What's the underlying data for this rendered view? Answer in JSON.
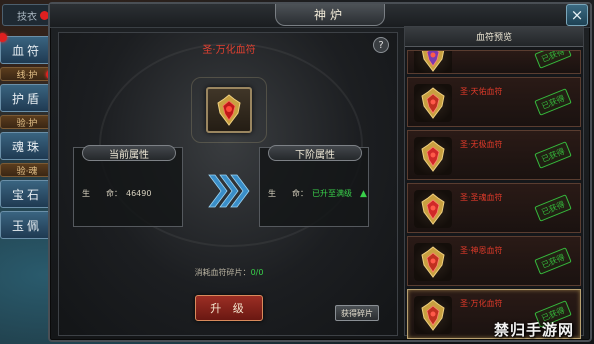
{
  "side": {
    "top_label": "技衣",
    "tabs": [
      {
        "label": "血符",
        "type": "main"
      },
      {
        "label": "线·护",
        "type": "sub"
      },
      {
        "label": "护盾",
        "type": "main"
      },
      {
        "label": "验·护",
        "type": "sub"
      },
      {
        "label": "魂珠",
        "type": "main"
      },
      {
        "label": "验·魂",
        "type": "sub"
      },
      {
        "label": "宝石",
        "type": "main"
      },
      {
        "label": "玉佩",
        "type": "main"
      }
    ]
  },
  "window": {
    "title": "神炉",
    "close_icon": "×"
  },
  "furnace": {
    "title": "圣·万化血符",
    "help_icon": "?",
    "current_head": "当前属性",
    "next_head": "下阶属性",
    "current_attr": {
      "label": "生　　命：",
      "value": "46490"
    },
    "next_attr": {
      "label": "生　　命：",
      "value": "已升至满级"
    },
    "consume_label": "消耗血符碎片：",
    "consume_value": "0/0",
    "upgrade_label": "升 级",
    "get_label": "获得碎片"
  },
  "list": {
    "title": "血符预览",
    "items": [
      {
        "name": "",
        "stamp": "已获得",
        "color": "#7a3ab0"
      },
      {
        "name": "圣·天佑血符",
        "stamp": "已获得",
        "color": "#c03020"
      },
      {
        "name": "圣·无极血符",
        "stamp": "已获得",
        "color": "#d02828"
      },
      {
        "name": "圣·圣魂血符",
        "stamp": "已获得",
        "color": "#d02828"
      },
      {
        "name": "圣·神恩血符",
        "stamp": "已获得",
        "color": "#c03020"
      },
      {
        "name": "圣·万化血符",
        "stamp": "已获得",
        "color": "#c03020"
      }
    ]
  },
  "watermark": "禁归手游网"
}
